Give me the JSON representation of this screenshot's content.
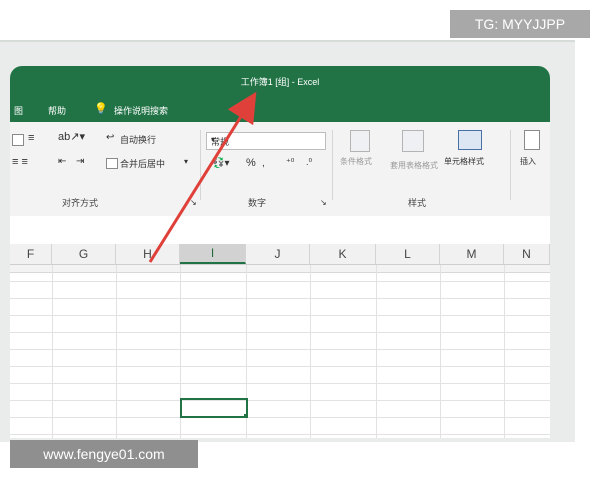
{
  "watermarks": {
    "top_right": "TG: MYYJJPP",
    "bottom_left": "www.fengye01.com"
  },
  "window": {
    "title": "工作簿1 [组] - Excel"
  },
  "menu": {
    "item_left": "图",
    "help": "帮助",
    "search": "操作说明搜索"
  },
  "ribbon": {
    "alignment": {
      "wrap_text": "自动换行",
      "merge_center": "合并后居中",
      "group_label": "对齐方式"
    },
    "number": {
      "format_value": "常规",
      "percent": "%",
      "group_label": "数字"
    },
    "styles": {
      "conditional_format": "条件格式",
      "table_format": "套用表格格式",
      "cell_styles": "单元格样式",
      "group_label": "样式"
    },
    "cells": {
      "insert": "插入"
    }
  },
  "columns": [
    "F",
    "G",
    "H",
    "I",
    "J",
    "K",
    "L",
    "M",
    "N"
  ],
  "selected_column": "I",
  "colors": {
    "excel_green": "#217346",
    "arrow_red": "#e0403a"
  },
  "icons": [
    "lightbulb-icon",
    "align-left-icon",
    "align-center-icon",
    "orientation-icon",
    "indent-decrease-icon",
    "indent-increase-icon",
    "wrap-text-icon",
    "merge-center-icon",
    "currency-icon",
    "comma-icon",
    "decimal-increase-icon",
    "decimal-decrease-icon",
    "conditional-format-icon",
    "table-format-icon",
    "cell-styles-icon",
    "insert-cells-icon",
    "dialog-launcher-icon"
  ]
}
